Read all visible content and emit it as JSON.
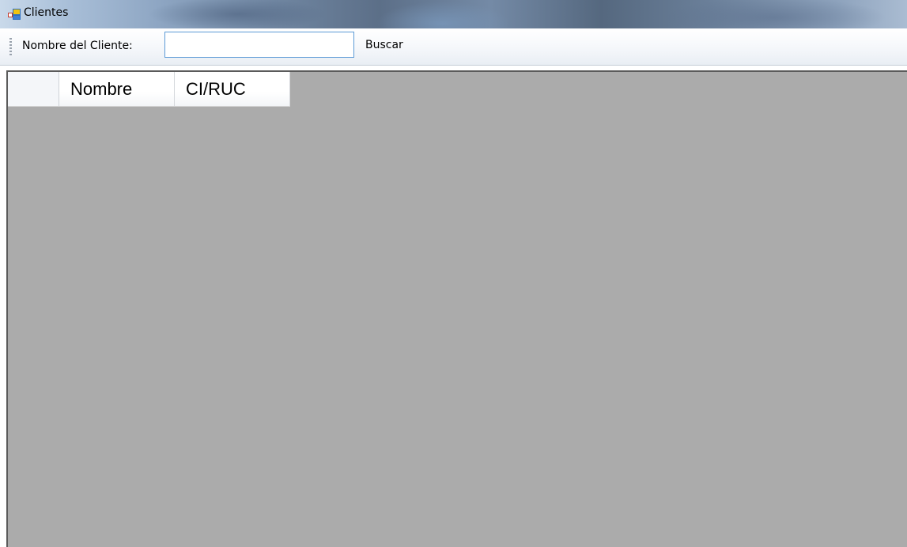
{
  "window": {
    "title": "Clientes"
  },
  "toolbar": {
    "label": "Nombre del Cliente:",
    "search_value": "",
    "search_placeholder": "",
    "button_label": "Buscar"
  },
  "grid": {
    "columns": [
      "Nombre",
      "CI/RUC"
    ],
    "rows": []
  },
  "colors": {
    "grid_background": "#ababab",
    "input_border_focus": "#5c9ad6"
  }
}
